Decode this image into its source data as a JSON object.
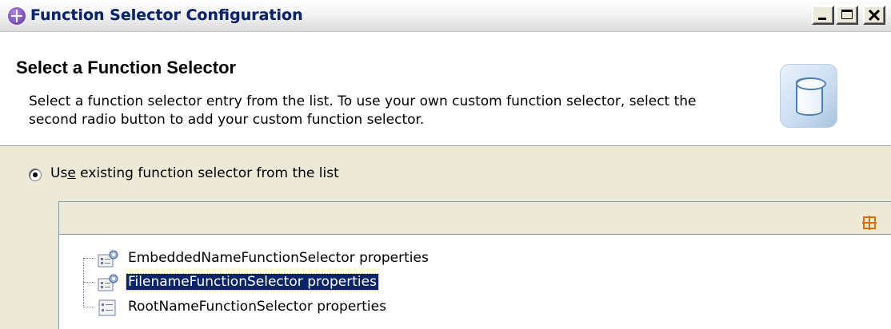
{
  "window": {
    "title": "Function Selector Configuration",
    "controls": [
      "minimize-icon",
      "maximize-icon",
      "close-icon"
    ]
  },
  "header": {
    "title": "Select a Function Selector",
    "description": "Select a function selector entry from the list. To use your own custom function selector, select the second radio button to add your custom function selector.",
    "icon": "database-icon"
  },
  "options": {
    "use_existing": {
      "label": "Use existing function selector from the list",
      "selected": true
    }
  },
  "list": {
    "header_icon": "expand-columns-icon",
    "items": [
      {
        "label": "EmbeddedNameFunctionSelector properties",
        "icon": "properties-gear-icon",
        "selected": false
      },
      {
        "label": "FilenameFunctionSelector properties",
        "icon": "properties-gear-icon",
        "selected": true
      },
      {
        "label": "RootNameFunctionSelector properties",
        "icon": "properties-icon",
        "selected": false
      }
    ]
  },
  "colors": {
    "title_text": "#0a246a",
    "selection_background": "#0a246a",
    "window_background": "#ece9d8"
  }
}
